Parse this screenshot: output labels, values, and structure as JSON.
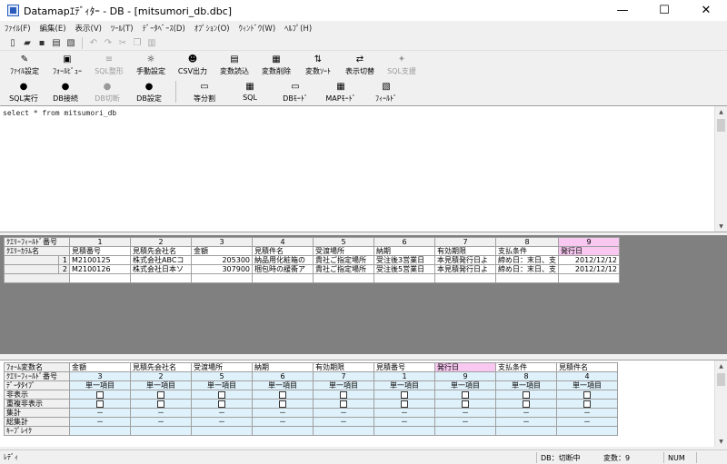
{
  "title": "Datamapｴﾃﾞｨﾀｰ - DB - [mitsumori_db.dbc]",
  "window": {
    "min": "—",
    "max": "☐",
    "close": "✕"
  },
  "menu": [
    "ﾌｧｲﾙ(F)",
    "編集(E)",
    "表示(V)",
    "ﾂｰﾙ(T)",
    "ﾃﾞｰﾀﾍﾞｰｽ(D)",
    "ｵﾌﾟｼｮﾝ(O)",
    "ｳｨﾝﾄﾞｳ(W)",
    "ﾍﾙﾌﾟ(H)"
  ],
  "toolbar2": [
    {
      "label": "ﾌｧｲﾙ設定",
      "icon": "file-settings-icon",
      "glyph": "✎",
      "dis": false
    },
    {
      "label": "ﾌｫｰﾙﾋﾞｭｰ",
      "icon": "form-view-icon",
      "glyph": "▣",
      "dis": false
    },
    {
      "label": "SQL整形",
      "icon": "sql-format-icon",
      "glyph": "≡",
      "dis": true
    },
    {
      "label": "手動設定",
      "icon": "manual-setting-icon",
      "glyph": "☼",
      "dis": false
    },
    {
      "label": "CSV出力",
      "icon": "csv-output-icon",
      "glyph": "☻",
      "dis": false
    },
    {
      "label": "変数読込",
      "icon": "variable-load-icon",
      "glyph": "▤",
      "dis": false
    },
    {
      "label": "変数削除",
      "icon": "variable-delete-icon",
      "glyph": "▦",
      "dis": false
    },
    {
      "label": "変数ｿｰﾄ",
      "icon": "variable-sort-icon",
      "glyph": "⇅",
      "dis": false
    },
    {
      "label": "表示切替",
      "icon": "display-switch-icon",
      "glyph": "⇄",
      "dis": false
    },
    {
      "label": "SQL支援",
      "icon": "sql-assist-icon",
      "glyph": "✦",
      "dis": true
    }
  ],
  "toolbar3": [
    {
      "label": "SQL実行",
      "icon": "sql-run-icon",
      "glyph": "●",
      "dis": false
    },
    {
      "label": "DB接続",
      "icon": "db-connect-icon",
      "glyph": "●",
      "dis": false
    },
    {
      "label": "DB切断",
      "icon": "db-disconnect-icon",
      "glyph": "●",
      "dis": true
    },
    {
      "label": "DB設定",
      "icon": "db-settings-icon",
      "glyph": "●",
      "dis": false
    },
    {
      "label": "等分割",
      "icon": "split-equal-icon",
      "glyph": "▭",
      "dis": false
    },
    {
      "label": "SQL",
      "icon": "sql-mode-icon",
      "glyph": "▦",
      "dis": false
    },
    {
      "label": "DBﾓｰﾄﾞ",
      "icon": "db-mode-icon",
      "glyph": "▭",
      "dis": false
    },
    {
      "label": "MAPﾓｰﾄﾞ",
      "icon": "map-mode-icon",
      "glyph": "▦",
      "dis": false
    },
    {
      "label": "ﾌｨｰﾙﾄﾞ",
      "icon": "field-icon",
      "glyph": "▧",
      "dis": false
    }
  ],
  "sql": "select * from mitsumori_db",
  "grid1": {
    "row_labels": [
      "ｸｴﾘｰﾌｨｰﾙﾄﾞ番号",
      "ｸｴﾘｰｶﾗﾑ名"
    ],
    "numbers": [
      "1",
      "2",
      "3",
      "4",
      "5",
      "6",
      "7",
      "8",
      "9"
    ],
    "columns": [
      "見積番号",
      "見積先会社名",
      "金額",
      "見積件名",
      "受渡場所",
      "納期",
      "有効期限",
      "支払条件",
      "発行日"
    ],
    "rows": [
      {
        "no": "1",
        "cells": [
          "M2100125",
          "株式会社ABCコ",
          "205300",
          "納品用化粧箱の",
          "貴社ご指定場所",
          "受注後3営業日",
          "本見積発行日よ",
          "締め日：末日、支",
          "2012/12/12"
        ]
      },
      {
        "no": "2",
        "cells": [
          "M2100126",
          "株式会社日本ソ",
          "307900",
          "梱包時の緩衝ア",
          "貴社ご指定場所",
          "受注後5営業日",
          "本見積発行日よ",
          "締め日：末日、支",
          "2012/12/12"
        ]
      }
    ]
  },
  "grid2": {
    "row_labels": [
      "ﾌｫｰﾑ変数名",
      "ｸｴﾘｰﾌｨｰﾙﾄﾞ番号",
      "ﾃﾞｰﾀﾀｲﾌﾟ",
      "非表示",
      "重複非表示",
      "集計",
      "総集計",
      "ｷｰﾌﾞﾚｲｸ"
    ],
    "columns": [
      "金額",
      "見積先会社名",
      "受渡場所",
      "納期",
      "有効期限",
      "見積番号",
      "発行日",
      "支払条件",
      "見積件名"
    ],
    "fields": [
      "3",
      "2",
      "5",
      "6",
      "7",
      "1",
      "9",
      "8",
      "4"
    ],
    "types": [
      "単一項目",
      "単一項目",
      "単一項目",
      "単一項目",
      "単一項目",
      "単一項目",
      "単一項目",
      "単一項目",
      "単一項目"
    ],
    "dash": "－"
  },
  "status": {
    "left": "ﾚﾃﾞｨ",
    "db": "DB：切断中",
    "vars": "変数：9",
    "num": "NUM"
  }
}
